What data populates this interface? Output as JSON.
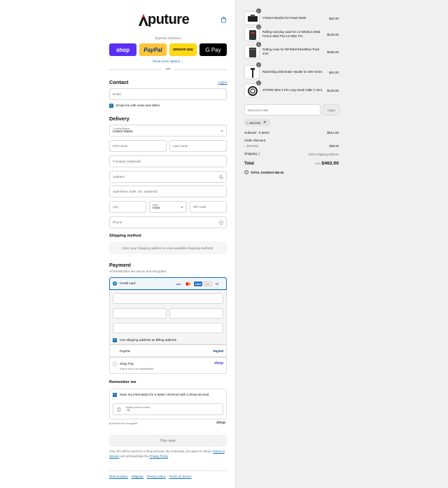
{
  "brand": {
    "wordmark": "puture",
    "accent": "#e11b22"
  },
  "express": {
    "label": "Express checkout",
    "buttons": [
      {
        "label": "shop",
        "color": "#5a31f4"
      },
      {
        "label": "PayPal",
        "color": "#ffc439"
      },
      {
        "label": "amazon pay",
        "color": "#ffd814"
      },
      {
        "label": "G Pay",
        "color": "#000000"
      }
    ],
    "more": "Show more options",
    "or": "OR"
  },
  "contact": {
    "heading": "Contact",
    "login": "Log in",
    "email_placeholder": "Email",
    "news_label": "Email me with news and offers"
  },
  "delivery": {
    "heading": "Delivery",
    "country_label": "Country/Region",
    "country_value": "United States",
    "first_name": "First name",
    "last_name": "Last name",
    "company": "Company (optional)",
    "address": "Address",
    "apartment": "Apartment, suite, etc. (optional)",
    "city": "City",
    "state_label": "State",
    "state_value": "Iowa",
    "zip": "ZIP code",
    "phone": "Phone"
  },
  "shipping": {
    "heading": "Shipping method",
    "message": "Enter your shipping address to view available shipping methods."
  },
  "payment": {
    "heading": "Payment",
    "subtitle": "All transactions are secure and encrypted.",
    "credit_card": "Credit card",
    "cards": [
      "VISA",
      "MC",
      "AMEX",
      "DISC"
    ],
    "more_cards": "+5",
    "billing_label": "Use shipping address as billing address",
    "paypal": "PayPal",
    "paypal_logo": "PayPal",
    "shoppay": "Shop Pay",
    "shoppay_sub": "Pay in full or in installments",
    "shoppay_logo": "shop"
  },
  "remember": {
    "heading": "Remember me",
    "save_label": "Save my information for a faster checkout with a Shop account",
    "phone_label": "Mobile phone number",
    "phone_value": "+1",
    "secure": "Secure and encrypted",
    "shop_logo": "shop"
  },
  "paynow": "Pay now",
  "fine_print": {
    "prefix": "Your info will be saved to a Shop account. By continuing, you agree to Shop's",
    "terms": "Terms of Service",
    "mid": "and acknowledge the",
    "privacy": "Privacy Policy",
    "end": "."
  },
  "footer": [
    "Refund policy",
    "Shipping",
    "Privacy policy",
    "Terms of service"
  ],
  "cart": {
    "items": [
      {
        "name": "V-Mount Bracket for Power Bank",
        "price": "$22.00",
        "qty": "1"
      },
      {
        "name": "Rolling Carrying Case for LS 600d/LS 600d Pro/LS 600x Pro/ LS 600c Pro",
        "price": "$146.00",
        "qty": "1"
      },
      {
        "name": "Rolling Case for INFINIMAT&Softbox Pack 4'x8'",
        "price": "$206.00",
        "qty": "1"
      },
      {
        "name": "Ratcheting Disk Brake Handle for 300 Series",
        "price": "$15.00",
        "qty": "1"
      },
      {
        "name": "STORM 400x 3 Pin Long Head Cable (7.5m)",
        "price": "$129.00",
        "qty": "1"
      }
    ],
    "discount_placeholder": "Discount code",
    "apply": "Apply",
    "chip": "BACK50",
    "subtotal_label": "Subtotal · 5 items",
    "subtotal_value": "$512.00",
    "order_discount_label": "Order discount",
    "discount_code": "BACK50",
    "discount_value": "−$50.00",
    "shipping_label": "Shipping",
    "shipping_value": "Enter shipping address",
    "total_label": "Total",
    "currency": "USD",
    "total_value": "$462.00",
    "savings": "TOTAL SAVINGS $50.00"
  }
}
